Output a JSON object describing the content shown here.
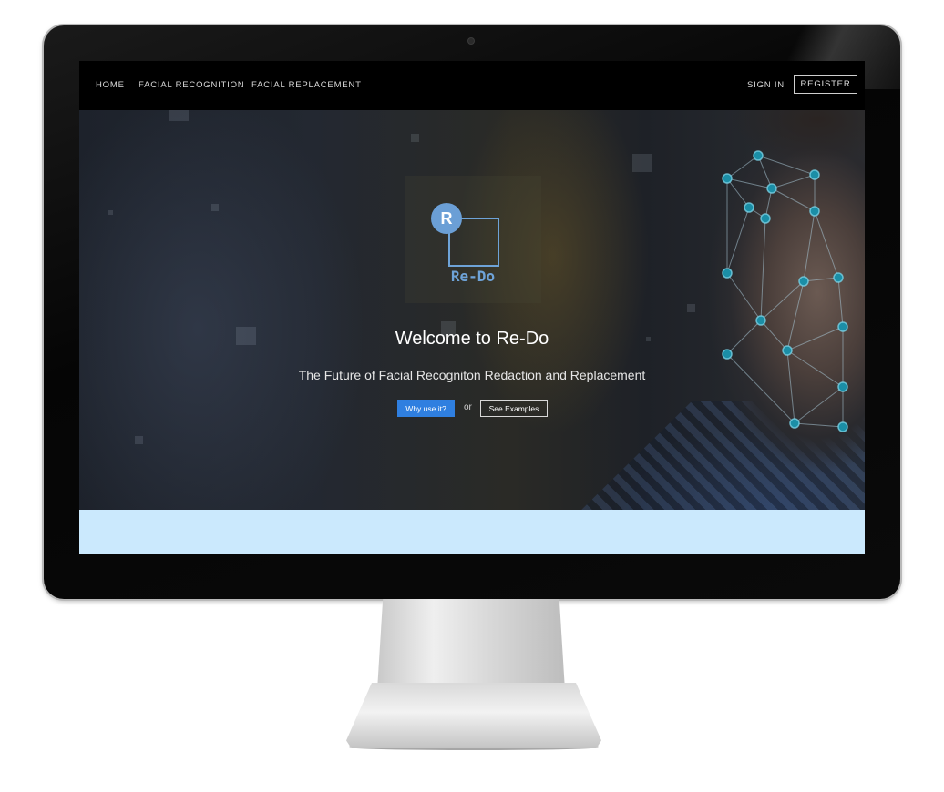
{
  "nav": {
    "home": "HOME",
    "facial_recognition": "FACIAL RECOGNITION",
    "facial_replacement": "FACIAL REPLACEMENT",
    "sign_in": "SIGN IN",
    "register": "REGISTER"
  },
  "logo": {
    "letter": "R",
    "text": "Re-Do"
  },
  "hero": {
    "title": "Welcome to Re-Do",
    "subtitle": "The Future of Facial Recogniton Redaction and Replacement",
    "primary_button": "Why use it?",
    "or_text": "or",
    "secondary_button": "See Examples"
  },
  "colors": {
    "primary_button": "#2f7fe0",
    "logo_accent": "#6ea3d8",
    "light_band": "#cbe9fd",
    "nav_background": "#000000"
  },
  "icons": {
    "face_mesh": "facial-landmark-mesh"
  }
}
